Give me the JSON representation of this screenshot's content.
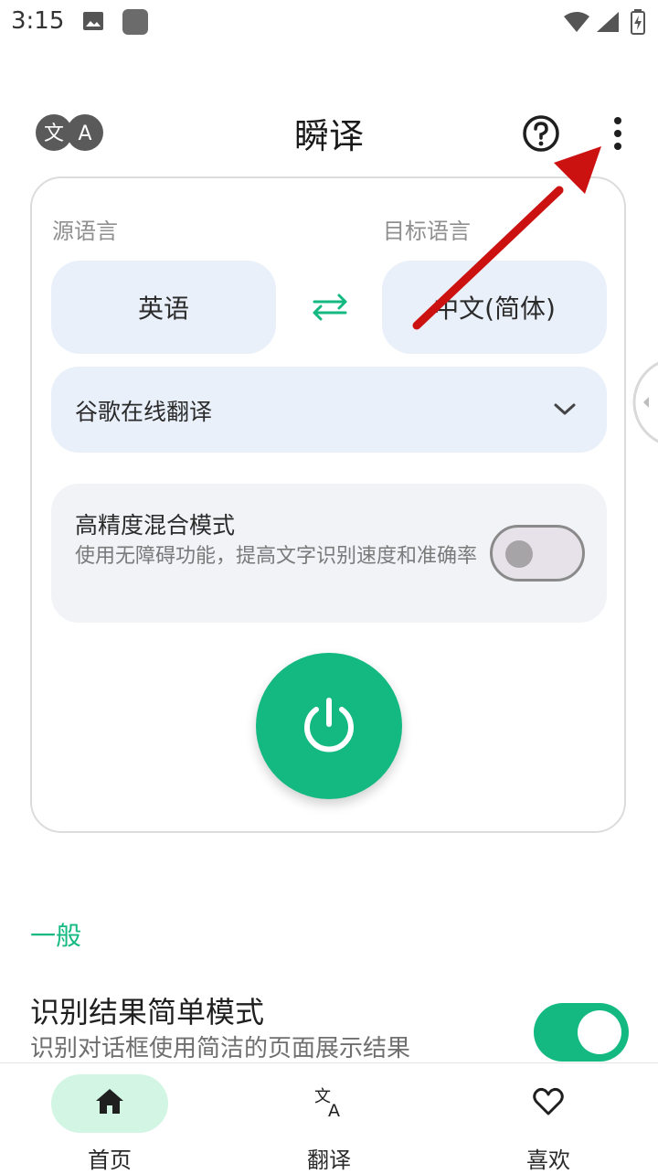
{
  "status_bar": {
    "time": "3:15"
  },
  "header": {
    "title": "瞬译",
    "logo_letters": [
      "文",
      "A"
    ]
  },
  "translate_card": {
    "source_label": "源语言",
    "target_label": "目标语言",
    "source_language": "英语",
    "target_language": "中文(简体)",
    "engine": "谷歌在线翻译",
    "mode_title": "高精度混合模式",
    "mode_description": "使用无障碍功能，提高文字识别速度和准确率",
    "mode_enabled": false
  },
  "settings": {
    "section_title": "一般",
    "items": [
      {
        "title": "识别结果简单模式",
        "description": "识别对话框使用简洁的页面展示结果",
        "enabled": true
      }
    ]
  },
  "bottom_nav": {
    "items": [
      {
        "label": "首页",
        "icon": "home-icon",
        "active": true
      },
      {
        "label": "翻译",
        "icon": "translate-icon",
        "active": false
      },
      {
        "label": "喜欢",
        "icon": "heart-icon",
        "active": false
      }
    ]
  },
  "colors": {
    "accent": "#13b981",
    "chip": "#e9f0fa",
    "panel": "#f1f3f7",
    "nav_active": "#d3f5e3",
    "annotation": "#cc1111"
  }
}
